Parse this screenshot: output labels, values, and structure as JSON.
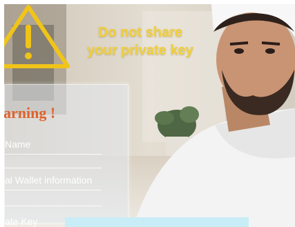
{
  "headline": {
    "line1": "Do not share",
    "line2": "your private key"
  },
  "panel": {
    "title": "arning !",
    "fields": [
      "Name",
      "al Wallet information",
      "ate Key"
    ]
  },
  "colors": {
    "headline": "#f1cf3a",
    "warning": "#f0c419",
    "panel_title": "#e0622b",
    "cyan_bar": "#c8edf7"
  },
  "icons": {
    "warning": "warning-triangle-icon"
  }
}
